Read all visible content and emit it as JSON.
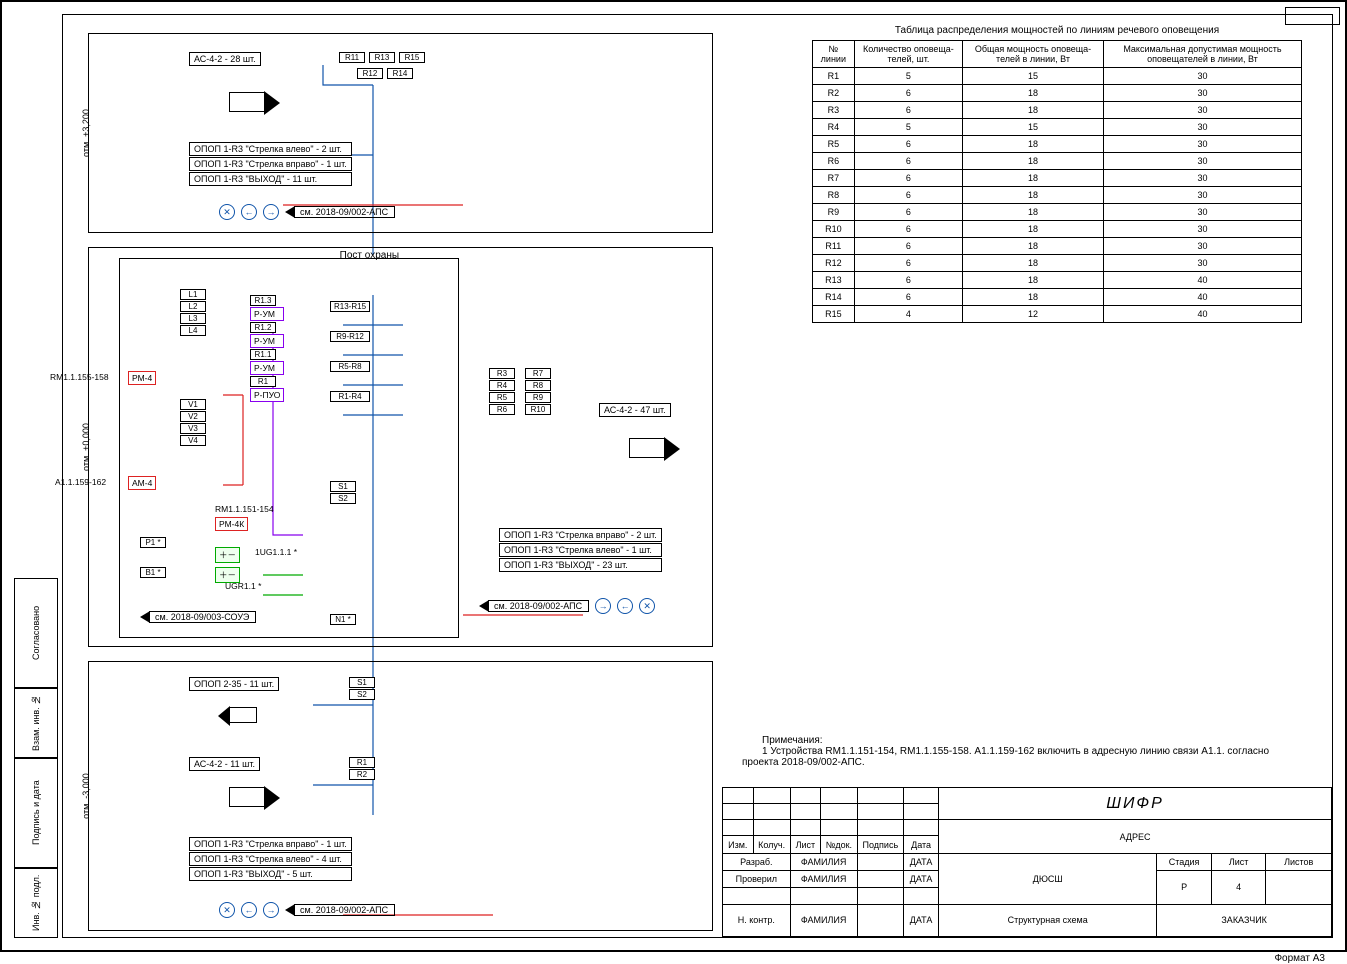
{
  "power_table": {
    "title": "Таблица распределения мощностей по линиям речевого оповещения",
    "headers": [
      "№ линии",
      "Количество оповеща-телей, шт.",
      "Общая мощность оповеща-телей в линии, Вт",
      "Максимальная допустимая мощность оповещателей в линии, Вт"
    ],
    "rows": [
      [
        "R1",
        "5",
        "15",
        "30"
      ],
      [
        "R2",
        "6",
        "18",
        "30"
      ],
      [
        "R3",
        "6",
        "18",
        "30"
      ],
      [
        "R4",
        "5",
        "15",
        "30"
      ],
      [
        "R5",
        "6",
        "18",
        "30"
      ],
      [
        "R6",
        "6",
        "18",
        "30"
      ],
      [
        "R7",
        "6",
        "18",
        "30"
      ],
      [
        "R8",
        "6",
        "18",
        "30"
      ],
      [
        "R9",
        "6",
        "18",
        "30"
      ],
      [
        "R10",
        "6",
        "18",
        "30"
      ],
      [
        "R11",
        "6",
        "18",
        "30"
      ],
      [
        "R12",
        "6",
        "18",
        "30"
      ],
      [
        "R13",
        "6",
        "18",
        "40"
      ],
      [
        "R14",
        "6",
        "18",
        "40"
      ],
      [
        "R15",
        "4",
        "12",
        "40"
      ]
    ]
  },
  "notes": {
    "heading": "Примечания:",
    "text": "1  Устройства RM1.1.151-154, RM1.1.155-158. А1.1.159-162 включить в адресную линию связи А1.1. согласно проекта 2018-09/002-АПС."
  },
  "title_block": {
    "shifr": "ШИФР",
    "address": "АДРЕС",
    "project": "ДЮСШ",
    "subtitle": "Структурная схема",
    "customer": "ЗАКАЗЧИК",
    "stage_h": "Стадия",
    "sheet_h": "Лист",
    "sheets_h": "Листов",
    "stage": "Р",
    "sheet": "4",
    "sheets": "",
    "cols": [
      "Изм.",
      "Колуч.",
      "Лист",
      "№док.",
      "Подпись",
      "Дата"
    ],
    "roles": {
      "dev": "Разраб.",
      "check": "Проверил",
      "ncontrol": "Н. контр."
    },
    "family": "ФАМИЛИЯ",
    "date": "ДАТА"
  },
  "left_strip": [
    "Согласовано",
    "Взам. инв. №",
    "Подпись и дата",
    "Инв. № подл."
  ],
  "format": "Формат А3",
  "floors": {
    "f1": {
      "elev": "отм. +3,200",
      "ac": "АС-4-2  - 28 шт.",
      "r_top": [
        "R11",
        "R13",
        "R15"
      ],
      "r_bot": [
        "R12",
        "R14"
      ],
      "opop": [
        "ОПОП 1-R3 \"Стрелка влево\" - 2 шт.",
        "ОПОП 1-R3 \"Стрелка вправо\" - 1 шт.",
        "ОПОП 1-R3 \"ВЫХОД\" - 11 шт."
      ],
      "ref": "см. 2018-09/002-АПС"
    },
    "f2": {
      "elev": "отм. +0,000",
      "title": "Пост охраны",
      "L": [
        "L1",
        "L2",
        "L3",
        "L4"
      ],
      "V": [
        "V1",
        "V2",
        "V3",
        "V4"
      ],
      "R": [
        "R1.3",
        "R1.2",
        "R1.1",
        "R1"
      ],
      "amp_top": [
        "Р-УМ",
        "Р-УМ",
        "Р-УМ",
        "Р-ПУО"
      ],
      "groups": [
        "R13-R15",
        "R9-R12",
        "R5-R8",
        "R1-R4"
      ],
      "rm_l": "RM1.1.155-158",
      "rm_box": "РМ-4",
      "am_l": "А1.1.159-162",
      "am_box": "АМ-4",
      "rm2_l": "RM1.1.151-154",
      "rm2_box": "РМ-4К",
      "P": "P1 *",
      "B": "B1 *",
      "ug1": "1UG1.1.1 *",
      "ug2": "UGR1.1 *",
      "S": [
        "S1",
        "S2"
      ],
      "N": "N1 *",
      "ref_left": "см. 2018-09/003-СОУЭ",
      "rmatrix_l": [
        "R3",
        "R4",
        "R5",
        "R6"
      ],
      "rmatrix_r": [
        "R7",
        "R8",
        "R9",
        "R10"
      ],
      "ac": "АС-4-2  - 47 шт.",
      "opop": [
        "ОПОП 1-R3 \"Стрелка вправо\" - 2 шт.",
        "ОПОП 1-R3 \"Стрелка влево\" - 1 шт.",
        "ОПОП 1-R3 \"ВЫХОД\" - 23 шт."
      ],
      "ref": "см. 2018-09/002-АПС"
    },
    "f3": {
      "elev": "отм. -3,000",
      "opop235": "ОПОП 2-35 - 11 шт.",
      "S": [
        "S1",
        "S2"
      ],
      "ac": "АС-4-2  - 11 шт.",
      "R": [
        "R1",
        "R2"
      ],
      "opop": [
        "ОПОП 1-R3 \"Стрелка вправо\" - 1 шт.",
        "ОПОП 1-R3 \"Стрелка влево\" - 4 шт.",
        "ОПОП 1-R3 \"ВЫХОД\" - 5 шт."
      ],
      "ref": "см. 2018-09/002-АПС"
    }
  }
}
